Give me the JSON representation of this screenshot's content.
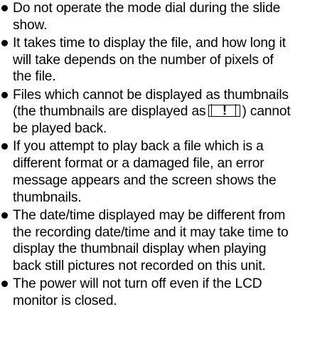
{
  "notes": [
    {
      "lines": [
        "Do not operate the mode dial during the slide",
        "show."
      ]
    },
    {
      "lines": [
        "It takes time to display the file, and how long it",
        "will take depends on the number of pixels of",
        "the file."
      ]
    },
    {
      "lines": [
        "Files which cannot be displayed as thumbnails",
        "(the thumbnails are displayed as",
        ") cannot",
        "be played back."
      ],
      "icon": "exclamation-thumbnail-icon",
      "icon_glyph": "!"
    },
    {
      "lines": [
        "If you attempt to play back a file which is a",
        "different format or a damaged file, an error",
        "message appears and the screen shows the",
        "thumbnails."
      ]
    },
    {
      "lines": [
        "The date/time displayed may be different from",
        "the recording date/time and it may take time to",
        "display the thumbnail display when playing",
        "back still pictures not recorded on this unit."
      ]
    },
    {
      "lines": [
        "The power will not turn off even if the LCD",
        "monitor is closed."
      ]
    }
  ]
}
